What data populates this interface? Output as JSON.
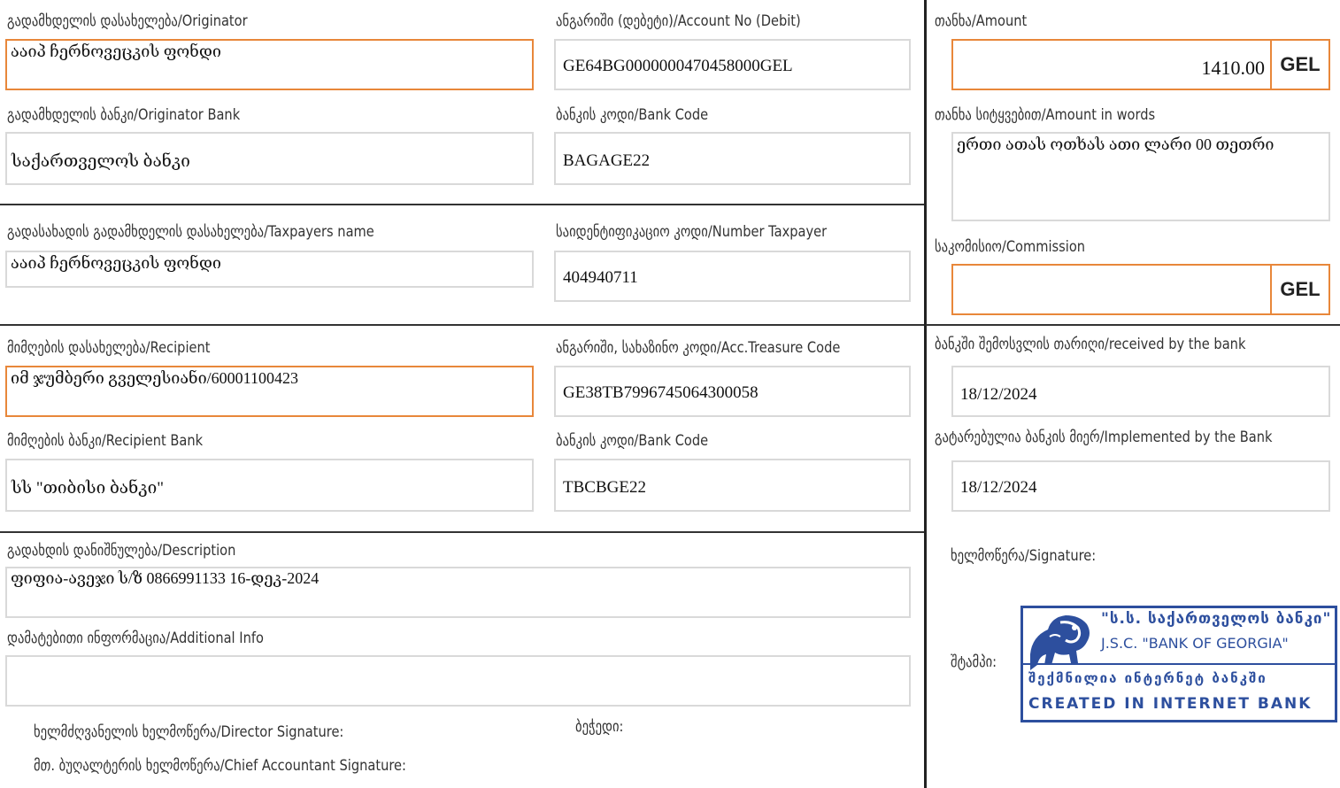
{
  "left": {
    "originator": {
      "label": "გადამხდელის დასახელება/Originator",
      "value": "ააიპ ჩერნოვეცკის ფონდი"
    },
    "account_debit": {
      "label": "ანგარიში (დებეტი)/Account No (Debit)",
      "value": "GE64BG0000000470458000GEL"
    },
    "originator_bank": {
      "label": "გადამხდელის ბანკი/Originator Bank",
      "value": "საქართველოს ბანკი"
    },
    "originator_bank_code": {
      "label": "ბანკის კოდი/Bank Code",
      "value": "BAGAGE22"
    },
    "taxpayer_name": {
      "label": "გადასახადის გადამხდელის დასახელება/Taxpayers name",
      "value": "ააიპ ჩერნოვეცკის ფონდი"
    },
    "taxpayer_number": {
      "label": "საიდენტიფიკაციო კოდი/Number Taxpayer",
      "value": "404940711"
    },
    "recipient": {
      "label": "მიმღების დასახელება/Recipient",
      "value": "იმ ჯუმბერი გველესიანი/60001100423"
    },
    "treasury_code": {
      "label": "ანგარიში, სახაზინო კოდი/Acc.Treasure Code",
      "value": "GE38TB7996745064300058"
    },
    "recipient_bank": {
      "label": "მიმღების ბანკი/Recipient Bank",
      "value": "სს \"თიბისი  ბანკი\""
    },
    "recipient_bank_code": {
      "label": "ბანკის კოდი/Bank Code",
      "value": "TBCBGE22"
    },
    "description": {
      "label": "გადახდის დანიშნულება/Description",
      "value": "ფიფია-ავეჯი ს/ზ 0866991133 16-დეკ-2024"
    },
    "additional_info": {
      "label": "დამატებითი ინფორმაცია/Additional Info",
      "value": ""
    },
    "director_signature": {
      "label": "ხელმძღვანელის ხელმოწერა/Director Signature:"
    },
    "seal": {
      "label": "ბეჭედი:"
    },
    "accountant_signature": {
      "label": "მთ. ბუღალტერის ხელმოწერა/Chief Accountant Signature:"
    }
  },
  "right": {
    "amount": {
      "label": "თანხა/Amount",
      "value": "1410.00",
      "currency": "GEL"
    },
    "amount_words": {
      "label": "თანხა სიტყვებით/Amount in words",
      "value": "ერთი ათას ოთხას ათი ლარი 00 თეთრი"
    },
    "commission": {
      "label": "საკომისიო/Commission",
      "value": "",
      "currency": "GEL"
    },
    "received_date": {
      "label": "ბანკში შემოსვლის თარიღი/received by the bank",
      "value": "18/12/2024"
    },
    "implemented_date": {
      "label": "გატარებულია ბანკის მიერ/Implemented by the Bank",
      "value": "18/12/2024"
    },
    "signature": {
      "label": "ხელმოწერა/Signature:"
    },
    "stamp_label": "შტამპი:"
  },
  "stamp": {
    "line1": "\"ს.ს. საქართველოს ბანკი\"",
    "line2": "J.S.C. \"BANK OF GEORGIA\"",
    "line3": "შექმნილია ინტერნეტ ბანკში",
    "line4": "CREATED IN INTERNET BANK",
    "color": "#2d4f9e"
  },
  "colors": {
    "accent": "#e8873a",
    "border": "#d9d9d9",
    "divider": "#333333"
  }
}
